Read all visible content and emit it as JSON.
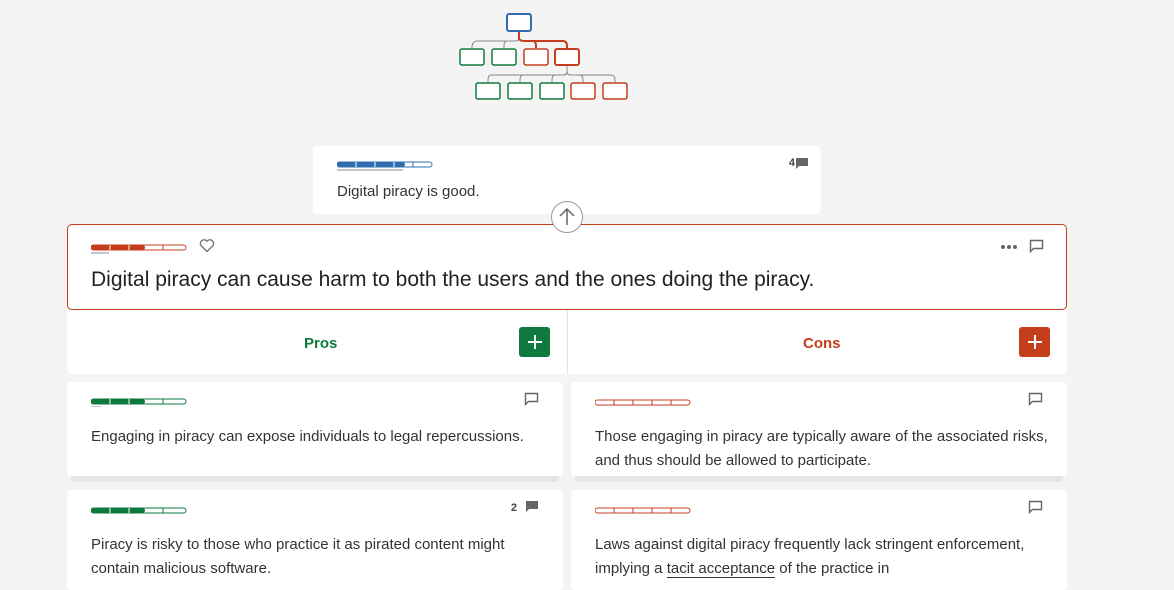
{
  "colors": {
    "accent_blue": "#2f6db0",
    "pro_green": "#0e7a3f",
    "con_red": "#c43e1c",
    "background": "#f4f4f4"
  },
  "parent": {
    "text": "Digital piracy is good.",
    "comment_count": "4",
    "comment_icon": "comment-filled-icon"
  },
  "focus": {
    "text": "Digital piracy can cause harm to both the users and the ones doing the piracy.",
    "icons": [
      "heart-icon",
      "more-icon",
      "comment-icon"
    ]
  },
  "columns": {
    "pros_label": "Pros",
    "cons_label": "Cons",
    "add_icon": "plus-icon"
  },
  "pros": [
    {
      "text": "Engaging in piracy can expose individuals to legal repercussions.",
      "comment_count": ""
    },
    {
      "text": "Piracy is risky to those who practice it as pirated content might contain malicious software.",
      "comment_count": "2"
    }
  ],
  "cons": [
    {
      "text": "Those engaging in piracy are typically aware of the associated risks, and thus should be allowed to participate.",
      "comment_count": ""
    },
    {
      "text_before": "Laws against digital piracy frequently lack stringent enforcement, implying a ",
      "text_link": "tacit acceptance",
      "text_after": " of the practice in"
    }
  ]
}
